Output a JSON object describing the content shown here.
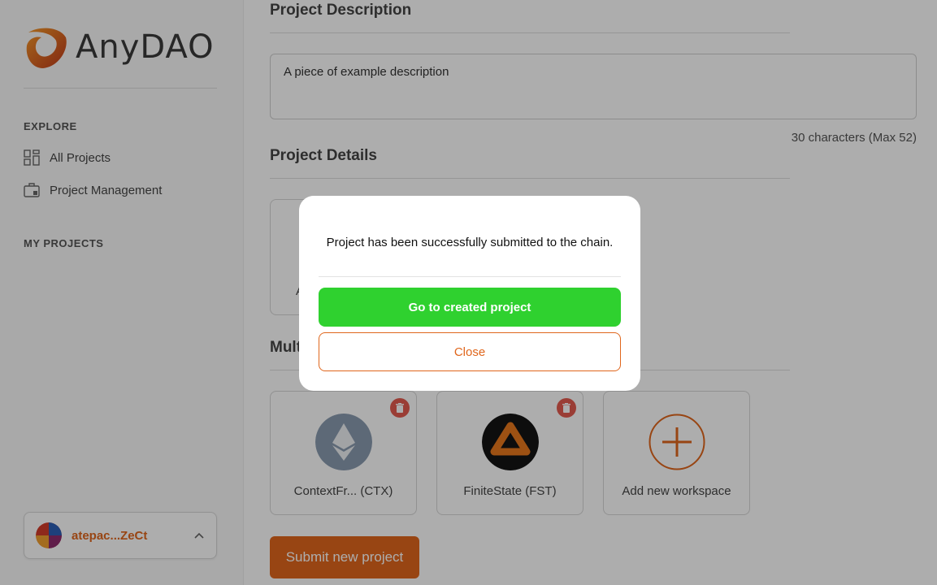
{
  "brand": {
    "name": "AnyDAO"
  },
  "sidebar": {
    "explore_title": "EXPLORE",
    "items": [
      {
        "label": "All Projects",
        "icon": "grid-icon"
      },
      {
        "label": "Project Management",
        "icon": "briefcase-icon"
      }
    ],
    "my_projects_title": "MY PROJECTS",
    "account": {
      "name": "atepac...ZeCt",
      "icon": "chevron-up-icon"
    }
  },
  "main": {
    "description_title": "Project Description",
    "description_value": "A piece of example description",
    "char_count": "30 characters (Max 52)",
    "details_title": "Project Details",
    "detail_card_partial": "A",
    "workspaces_title_partial": "Mult",
    "workspaces": [
      {
        "label": "ContextFr... (CTX)",
        "icon": "ethereum-icon"
      },
      {
        "label": "FiniteState (FST)",
        "icon": "finitestate-logo"
      },
      {
        "label": "Add new workspace",
        "icon": "plus-circle-icon"
      }
    ],
    "submit_label": "Submit new project"
  },
  "modal": {
    "message": "Project has been successfully submitted to the chain.",
    "primary_label": "Go to created project",
    "secondary_label": "Close"
  },
  "colors": {
    "accent": "#e0661c",
    "success": "#2fd12f",
    "danger": "#e45a4e"
  }
}
